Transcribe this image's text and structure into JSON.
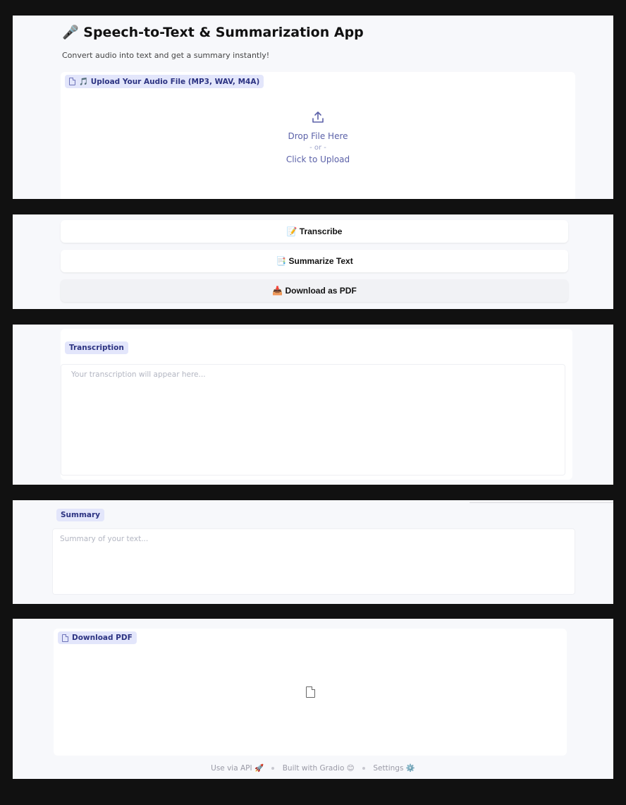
{
  "app": {
    "title": "🎤 Speech-to-Text & Summarization App",
    "subtitle": "Convert audio into text and get a summary instantly!"
  },
  "upload": {
    "label": "🎵 Upload Your Audio File (MP3, WAV, M4A)",
    "drop_text": "Drop File Here",
    "or_text": "- or -",
    "click_text": "Click to Upload"
  },
  "actions": {
    "transcribe": "📝 Transcribe",
    "summarize": "📑 Summarize Text",
    "download": "📥 Download as PDF"
  },
  "transcription": {
    "label": "Transcription",
    "placeholder": "Your transcription will appear here..."
  },
  "summary": {
    "label": "Summary",
    "placeholder": "Summary of your text..."
  },
  "download_pdf": {
    "label": "Download PDF"
  },
  "footer": {
    "api": "Use via API 🚀",
    "built": "Built with Gradio 😊",
    "settings": "Settings ⚙️"
  },
  "colors": {
    "accent": "#2c3382",
    "chip_bg": "#e3e6fb",
    "page_bg": "#f7f8fb",
    "frame": "#111111"
  },
  "icons": {
    "upload": "upload-arrow-icon",
    "file": "file-icon"
  }
}
